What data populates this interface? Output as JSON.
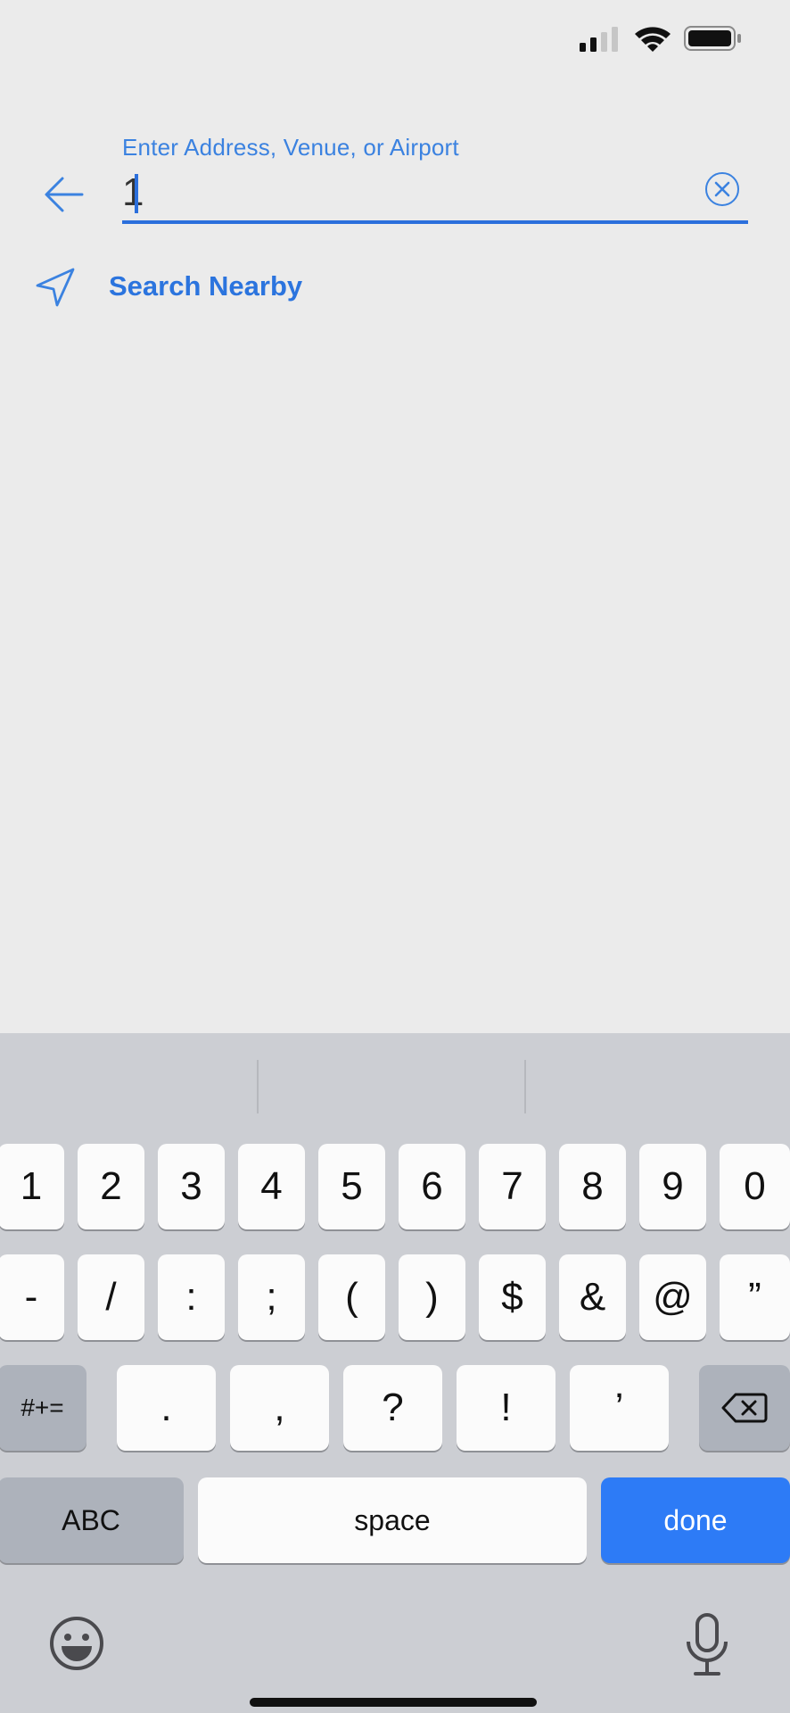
{
  "search": {
    "label": "Enter Address, Venue, or Airport",
    "value": "1"
  },
  "nearby": {
    "label": "Search Nearby"
  },
  "keyboard": {
    "row1": [
      "1",
      "2",
      "3",
      "4",
      "5",
      "6",
      "7",
      "8",
      "9",
      "0"
    ],
    "row2": [
      "-",
      "/",
      ":",
      ";",
      "(",
      ")",
      "$",
      "&",
      "@",
      "”"
    ],
    "row3": {
      "mode": "#+=",
      "keys": [
        ".",
        ",",
        "?",
        "!",
        "’"
      ]
    },
    "abc": "ABC",
    "space": "space",
    "done": "done"
  },
  "colors": {
    "accent": "#2b74de",
    "done_key": "#2d7bf6"
  }
}
